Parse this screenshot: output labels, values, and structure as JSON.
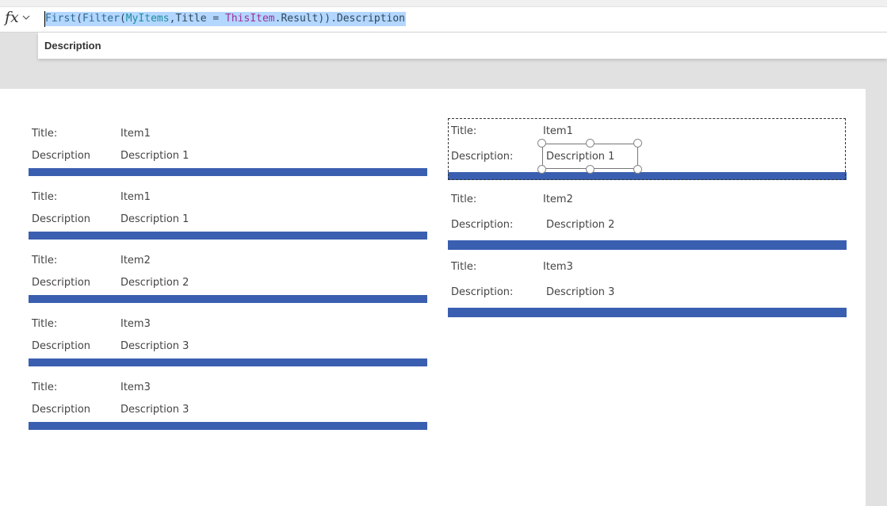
{
  "formula_bar": {
    "fx_label": "fx",
    "tokens": {
      "first": "First",
      "paren1": "(",
      "filter": "Filter",
      "paren2": "(",
      "myitems": "MyItems",
      "mid": ",Title = ",
      "thisitem": "ThisItem",
      "tail": ".Result)).Description"
    }
  },
  "intellisense": {
    "suggestion": "Description"
  },
  "left_gallery": {
    "items": [
      {
        "title_label": "Title:",
        "title_value": "Item1",
        "desc_label": "Description",
        "desc_value": "Description 1"
      },
      {
        "title_label": "Title:",
        "title_value": "Item1",
        "desc_label": "Description",
        "desc_value": "Description 1"
      },
      {
        "title_label": "Title:",
        "title_value": "Item2",
        "desc_label": "Description",
        "desc_value": "Description 2"
      },
      {
        "title_label": "Title:",
        "title_value": "Item3",
        "desc_label": "Description",
        "desc_value": "Description 3"
      },
      {
        "title_label": "Title:",
        "title_value": "Item3",
        "desc_label": "Description",
        "desc_value": "Description 3"
      }
    ]
  },
  "right_gallery": {
    "items": [
      {
        "title_label": "Title:",
        "title_value": "Item1",
        "desc_label": "Description:",
        "desc_value": "Description 1"
      },
      {
        "title_label": "Title:",
        "title_value": "Item2",
        "desc_label": "Description:",
        "desc_value": "Description 2"
      },
      {
        "title_label": "Title:",
        "title_value": "Item3",
        "desc_label": "Description:",
        "desc_value": "Description 3"
      }
    ]
  },
  "colors": {
    "separator": "#3a5fb0",
    "selection_highlight": "#b3d7ff"
  }
}
